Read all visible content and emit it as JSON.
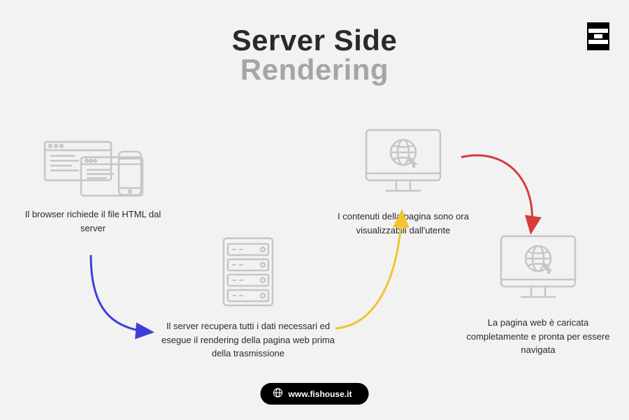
{
  "title": {
    "line1": "Server Side",
    "line2": "Rendering"
  },
  "steps": {
    "s1": "Il browser richiede il file HTML dal server",
    "s2": "Il server recupera tutti i dati necessari ed esegue il rendering della pagina web prima della trasmissione",
    "s3": "I contenuti della pagina sono ora visualizzabili dall'utente",
    "s4": "La pagina web è caricata completamente e pronta per essere navigata"
  },
  "footer": {
    "url": "www.fishouse.it"
  }
}
